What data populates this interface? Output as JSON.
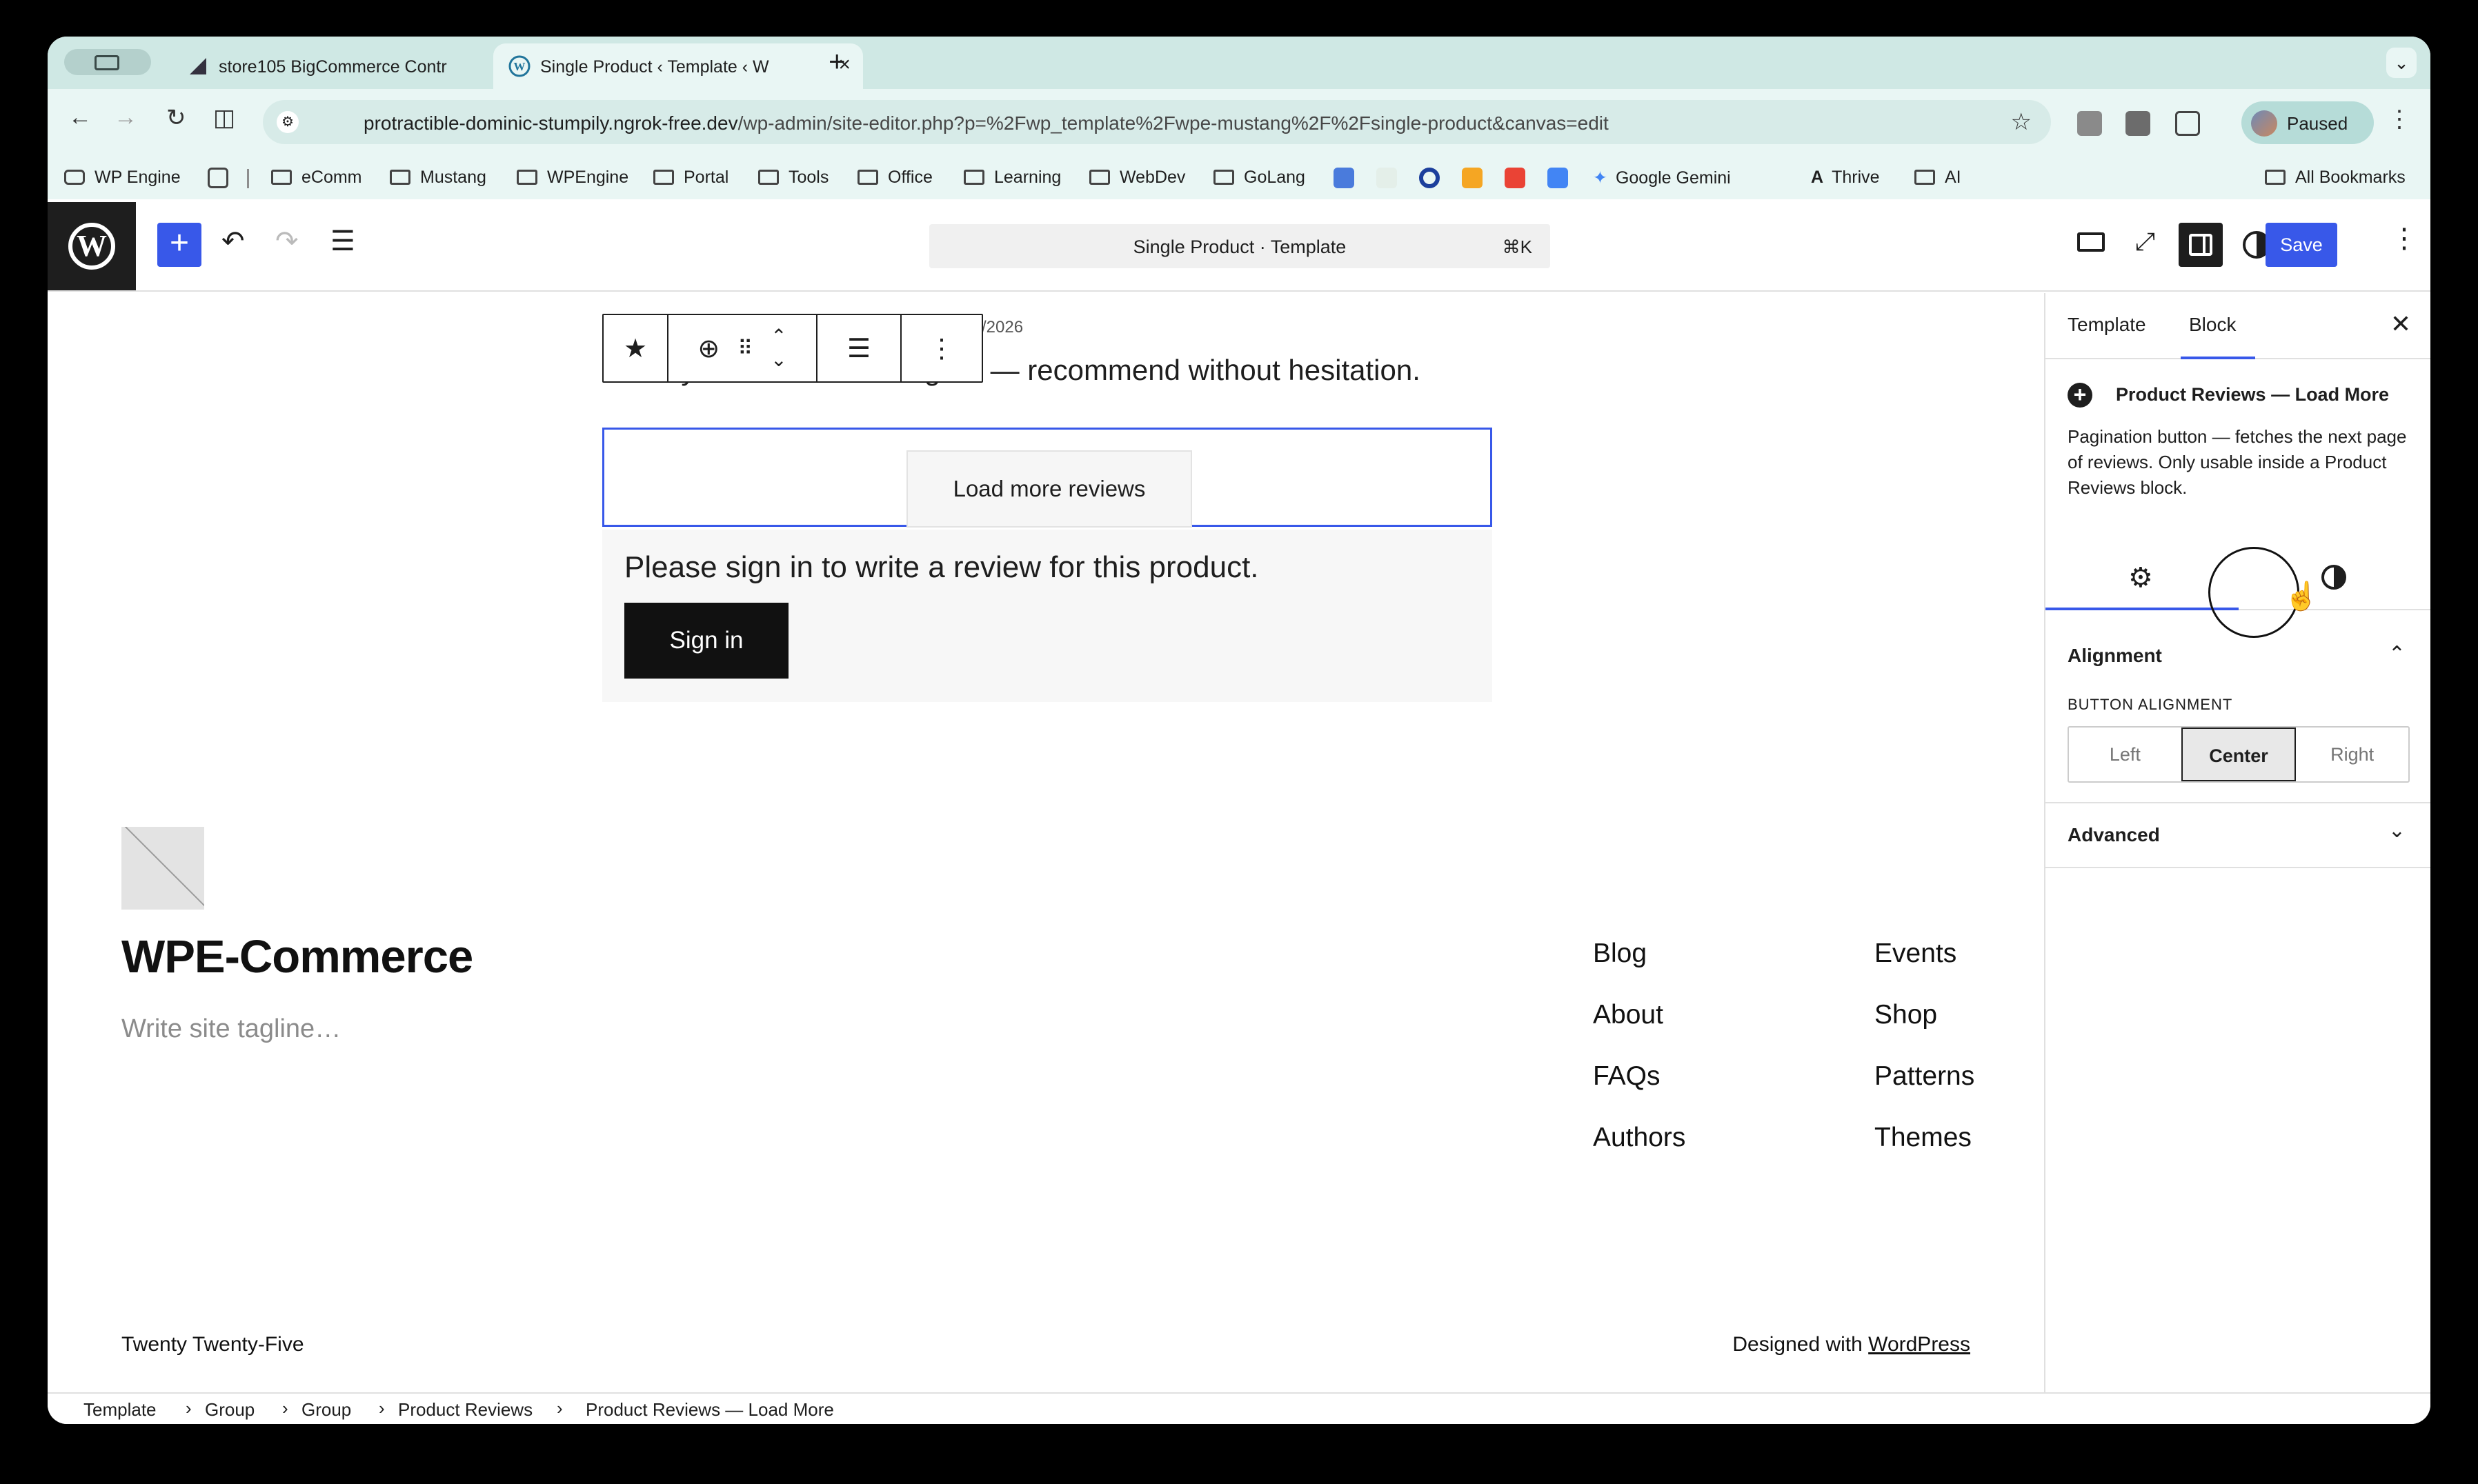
{
  "browser": {
    "tabs": [
      {
        "title": "store105 BigCommerce Contr",
        "favicon": "bigcommerce-icon"
      },
      {
        "title": "Single Product ‹ Template ‹ W",
        "favicon": "wordpress-icon",
        "active": true
      }
    ],
    "url_domain": "protractible-dominic-stumpily.ngrok-free.dev",
    "url_path": "/wp-admin/site-editor.php?p=%2Fwp_template%2Fwpe-mustang%2F%2Fsingle-product&canvas=edit",
    "profile_label": "Paused",
    "bookmarks": [
      "WP Engine",
      "eComm",
      "Mustang",
      "WPEngine",
      "Portal",
      "Tools",
      "Office",
      "Learning",
      "WebDev",
      "GoLang",
      "Google Gemini",
      "Thrive",
      "AI"
    ],
    "all_bookmarks": "All Bookmarks"
  },
  "editor": {
    "doc_title": "Single Product · Template",
    "shortcut": "⌘K",
    "save_label": "Save"
  },
  "canvas": {
    "review_date": "/2026",
    "review_text": "Exactly what I was looking for — recommend without hesitation.",
    "load_more_label": "Load more reviews",
    "signin_prompt": "Please sign in to write a review for this product.",
    "signin_button": "Sign in",
    "site_title": "WPE-Commerce",
    "site_tagline": "Write site tagline…",
    "nav_col1": [
      "Blog",
      "About",
      "FAQs",
      "Authors"
    ],
    "nav_col2": [
      "Events",
      "Shop",
      "Patterns",
      "Themes"
    ],
    "footer_theme": "Twenty Twenty-Five",
    "footer_designed": "Designed with ",
    "footer_wp_link": "WordPress"
  },
  "sidebar": {
    "tab_template": "Template",
    "tab_block": "Block",
    "block_title": "Product Reviews — Load More",
    "block_desc": "Pagination button — fetches the next page of reviews. Only usable inside a Product Reviews block.",
    "alignment_heading": "Alignment",
    "button_alignment_label": "BUTTON ALIGNMENT",
    "align_options": [
      "Left",
      "Center",
      "Right"
    ],
    "align_selected": "Center",
    "advanced_heading": "Advanced"
  },
  "breadcrumbs": [
    "Template",
    "Group",
    "Group",
    "Product Reviews",
    "Product Reviews — Load More"
  ],
  "colors": {
    "accent": "#3858e9",
    "chrome_bg": "#e9f6f4",
    "tabstrip_bg": "#cfe8e4"
  }
}
